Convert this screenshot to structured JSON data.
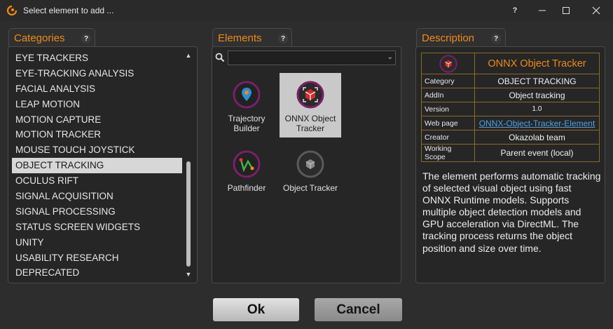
{
  "window": {
    "title": "Select element to add ...",
    "help_label": "?"
  },
  "categories": {
    "title": "Categories",
    "help": "?",
    "items": [
      "EYE TRACKERS",
      "EYE-TRACKING ANALYSIS",
      "FACIAL ANALYSIS",
      "LEAP MOTION",
      "MOTION CAPTURE",
      "MOTION TRACKER",
      "MOUSE TOUCH JOYSTICK",
      "OBJECT TRACKING",
      "OCULUS RIFT",
      "SIGNAL ACQUISITION",
      "SIGNAL PROCESSING",
      "STATUS SCREEN WIDGETS",
      "UNITY",
      "USABILITY RESEARCH",
      "DEPRECATED"
    ],
    "selected": "OBJECT TRACKING"
  },
  "elements": {
    "title": "Elements",
    "help": "?",
    "search_value": "",
    "items": [
      {
        "label": "Trajectory Builder",
        "icon": "trajectory-builder-icon"
      },
      {
        "label": "ONNX Object Tracker",
        "icon": "onnx-object-tracker-icon"
      },
      {
        "label": "Pathfinder",
        "icon": "pathfinder-icon"
      },
      {
        "label": "Object Tracker",
        "icon": "object-tracker-icon"
      }
    ],
    "selected": "ONNX Object Tracker"
  },
  "description": {
    "title": "Description",
    "help": "?",
    "element_name": "ONNX Object Tracker",
    "rows": [
      {
        "key": "Category",
        "value": "OBJECT TRACKING"
      },
      {
        "key": "AddIn",
        "value": "Object tracking"
      },
      {
        "key": "Version",
        "value": "1.0"
      },
      {
        "key": "Web page",
        "value": "ONNX-Object-Tracker-Element"
      },
      {
        "key": "Creator",
        "value": "Okazolab team"
      },
      {
        "key": "Working Scope",
        "value": "Parent event (local)"
      }
    ],
    "text": "The element performs automatic tracking of selected visual object using fast ONNX Runtime models. Supports multiple object detection models and GPU acceleration via DirectML. The tracking process returns the object position and size over time."
  },
  "buttons": {
    "ok": "Ok",
    "cancel": "Cancel"
  },
  "colors": {
    "accent": "#f08a1a",
    "link": "#4aa3e8",
    "icon_ring": "#7a1f6a"
  }
}
